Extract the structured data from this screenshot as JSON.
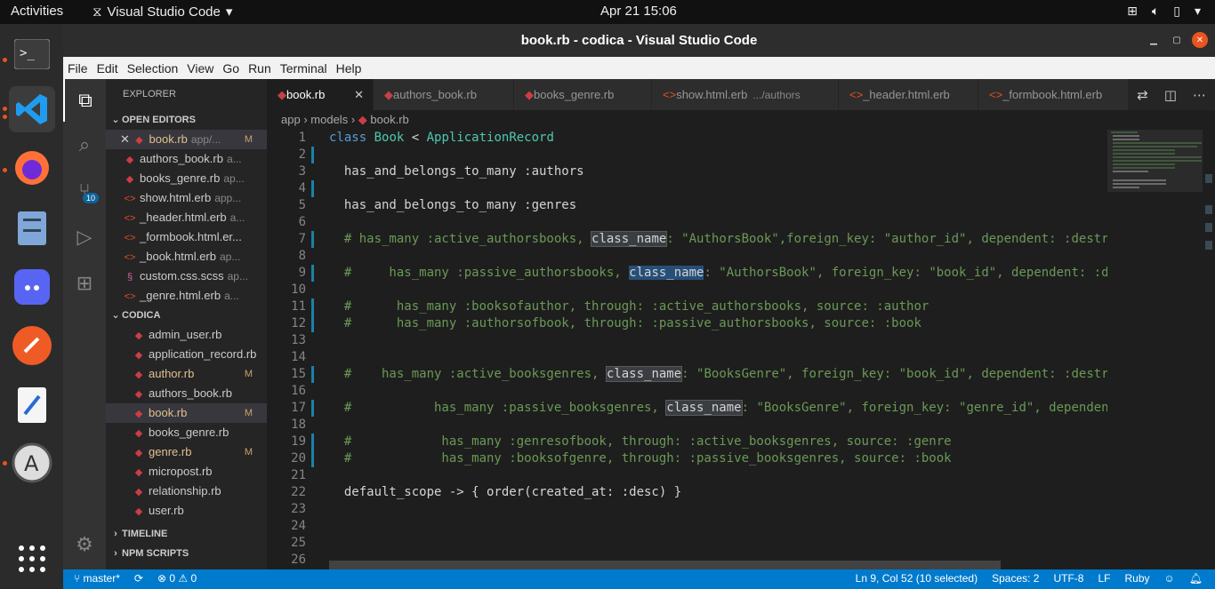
{
  "topbar": {
    "activities": "Activities",
    "app_name": "Visual Studio Code",
    "clock": "Apr 21  15:06"
  },
  "window": {
    "title": "book.rb - codica - Visual Studio Code"
  },
  "menu": [
    "File",
    "Edit",
    "Selection",
    "View",
    "Go",
    "Run",
    "Terminal",
    "Help"
  ],
  "activity_bar": {
    "scm_badge": "10"
  },
  "sidebar": {
    "explorer_title": "EXPLORER",
    "open_editors_title": "OPEN EDITORS",
    "open_editors": [
      {
        "name": "book.rb",
        "desc": "app/...",
        "mod": "M",
        "type": "ruby"
      },
      {
        "name": "authors_book.rb",
        "desc": "a...",
        "mod": "",
        "type": "ruby"
      },
      {
        "name": "books_genre.rb",
        "desc": "ap...",
        "mod": "",
        "type": "ruby"
      },
      {
        "name": "show.html.erb",
        "desc": "app...",
        "mod": "",
        "type": "html"
      },
      {
        "name": "_header.html.erb",
        "desc": "a...",
        "mod": "",
        "type": "html"
      },
      {
        "name": "_formbook.html.er...",
        "desc": "",
        "mod": "",
        "type": "html"
      },
      {
        "name": "_book.html.erb",
        "desc": "ap...",
        "mod": "",
        "type": "html"
      },
      {
        "name": "custom.css.scss",
        "desc": "ap...",
        "mod": "",
        "type": "css"
      },
      {
        "name": "_genre.html.erb",
        "desc": "a...",
        "mod": "",
        "type": "html"
      }
    ],
    "project_title": "CODICA",
    "project_files": [
      {
        "name": "admin_user.rb",
        "mod": ""
      },
      {
        "name": "application_record.rb",
        "mod": ""
      },
      {
        "name": "author.rb",
        "mod": "M"
      },
      {
        "name": "authors_book.rb",
        "mod": ""
      },
      {
        "name": "book.rb",
        "mod": "M"
      },
      {
        "name": "books_genre.rb",
        "mod": ""
      },
      {
        "name": "genre.rb",
        "mod": "M"
      },
      {
        "name": "micropost.rb",
        "mod": ""
      },
      {
        "name": "relationship.rb",
        "mod": ""
      },
      {
        "name": "user.rb",
        "mod": ""
      }
    ],
    "timeline_title": "TIMELINE",
    "npm_title": "NPM SCRIPTS"
  },
  "tabs": [
    {
      "name": "book.rb",
      "desc": "",
      "type": "ruby",
      "active": true
    },
    {
      "name": "authors_book.rb",
      "desc": "",
      "type": "ruby",
      "active": false
    },
    {
      "name": "books_genre.rb",
      "desc": "",
      "type": "ruby",
      "active": false
    },
    {
      "name": "show.html.erb",
      "desc": ".../authors",
      "type": "html",
      "active": false
    },
    {
      "name": "_header.html.erb",
      "desc": "",
      "type": "html",
      "active": false
    },
    {
      "name": "_formbook.html.erb",
      "desc": "",
      "type": "html",
      "active": false
    }
  ],
  "breadcrumb": [
    "app",
    "models",
    "book.rb"
  ],
  "code_lines": [
    {
      "n": "1",
      "mark": false,
      "segs": [
        [
          "kw",
          "class"
        ],
        [
          "t",
          " "
        ],
        [
          "cls",
          "Book"
        ],
        [
          "t",
          " < "
        ],
        [
          "cls",
          "ApplicationRecord"
        ]
      ]
    },
    {
      "n": "2",
      "mark": true,
      "segs": []
    },
    {
      "n": "3",
      "mark": false,
      "segs": [
        [
          "t",
          "  has_and_belongs_to_many :authors"
        ]
      ]
    },
    {
      "n": "4",
      "mark": true,
      "segs": []
    },
    {
      "n": "5",
      "mark": false,
      "segs": [
        [
          "t",
          "  has_and_belongs_to_many :genres"
        ]
      ]
    },
    {
      "n": "6",
      "mark": false,
      "segs": []
    },
    {
      "n": "7",
      "mark": true,
      "segs": [
        [
          "cm",
          "  # has_many :active_authorsbooks, "
        ],
        [
          "hl",
          "class_name"
        ],
        [
          "cm",
          ": \"AuthorsBook\",foreign_key: \"author_id\", dependent: :destroy"
        ]
      ]
    },
    {
      "n": "8",
      "mark": false,
      "segs": []
    },
    {
      "n": "9",
      "mark": true,
      "segs": [
        [
          "cm",
          "  #     has_many :passive_authorsbooks, "
        ],
        [
          "sel",
          "class_name"
        ],
        [
          "cm",
          ": \"AuthorsBook\", foreign_key: \"book_id\", dependent: :destroy"
        ]
      ]
    },
    {
      "n": "10",
      "mark": false,
      "segs": []
    },
    {
      "n": "11",
      "mark": true,
      "segs": [
        [
          "cm",
          "  #      has_many :booksofauthor, through: :active_authorsbooks, source: :author"
        ]
      ]
    },
    {
      "n": "12",
      "mark": true,
      "segs": [
        [
          "cm",
          "  #      has_many :authorsofbook, through: :passive_authorsbooks, source: :book"
        ]
      ]
    },
    {
      "n": "13",
      "mark": false,
      "segs": []
    },
    {
      "n": "14",
      "mark": false,
      "segs": []
    },
    {
      "n": "15",
      "mark": true,
      "segs": [
        [
          "cm",
          "  #    has_many :active_booksgenres, "
        ],
        [
          "hl",
          "class_name"
        ],
        [
          "cm",
          ": \"BooksGenre\", foreign_key: \"book_id\", dependent: :destroy"
        ]
      ]
    },
    {
      "n": "16",
      "mark": false,
      "segs": []
    },
    {
      "n": "17",
      "mark": true,
      "segs": [
        [
          "cm",
          "  #           has_many :passive_booksgenres, "
        ],
        [
          "hl",
          "class_name"
        ],
        [
          "cm",
          ": \"BooksGenre\", foreign_key: \"genre_id\", dependent: :destroy"
        ]
      ]
    },
    {
      "n": "18",
      "mark": false,
      "segs": []
    },
    {
      "n": "19",
      "mark": true,
      "segs": [
        [
          "cm",
          "  #            has_many :genresofbook, through: :active_booksgenres, source: :genre"
        ]
      ]
    },
    {
      "n": "20",
      "mark": true,
      "segs": [
        [
          "cm",
          "  #            has_many :booksofgenre, through: :passive_booksgenres, source: :book"
        ]
      ]
    },
    {
      "n": "21",
      "mark": false,
      "segs": []
    },
    {
      "n": "22",
      "mark": false,
      "segs": [
        [
          "t",
          "  default_scope -> { order(created_at: :desc) }"
        ]
      ]
    },
    {
      "n": "23",
      "mark": false,
      "segs": []
    },
    {
      "n": "24",
      "mark": false,
      "segs": []
    },
    {
      "n": "25",
      "mark": false,
      "segs": []
    },
    {
      "n": "26",
      "mark": false,
      "segs": []
    }
  ],
  "statusbar": {
    "branch": "master*",
    "problems": "⊗ 0 ⚠ 0",
    "position": "Ln 9, Col 52 (10 selected)",
    "spaces": "Spaces: 2",
    "encoding": "UTF-8",
    "eol": "LF",
    "language": "Ruby"
  },
  "colors": {
    "accent": "#007acc",
    "ubuntu_orange": "#e95420",
    "ruby_icon": "#cc3e44",
    "modified": "#e2c08d"
  }
}
